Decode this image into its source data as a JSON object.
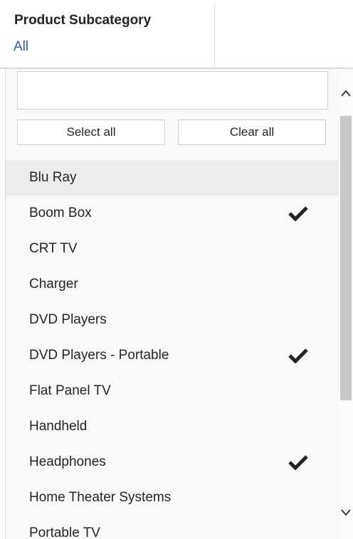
{
  "slicer": {
    "title": "Product Subcategory",
    "selected_value": "All",
    "search_value": "",
    "select_all_label": "Select all",
    "clear_all_label": "Clear all",
    "items": [
      {
        "label": "Blu Ray",
        "checked": false,
        "hovered": true
      },
      {
        "label": "Boom Box",
        "checked": true,
        "hovered": false
      },
      {
        "label": "CRT TV",
        "checked": false,
        "hovered": false
      },
      {
        "label": "Charger",
        "checked": false,
        "hovered": false
      },
      {
        "label": "DVD Players",
        "checked": false,
        "hovered": false
      },
      {
        "label": "DVD Players - Portable",
        "checked": true,
        "hovered": false
      },
      {
        "label": "Flat Panel TV",
        "checked": false,
        "hovered": false
      },
      {
        "label": "Handheld",
        "checked": false,
        "hovered": false
      },
      {
        "label": "Headphones",
        "checked": true,
        "hovered": false
      },
      {
        "label": "Home Theater Systems",
        "checked": false,
        "hovered": false
      },
      {
        "label": "Portable TV",
        "checked": false,
        "hovered": false
      }
    ],
    "icons": {
      "check": "checkmark-icon",
      "scroll_up": "chevron-up-icon",
      "scroll_down": "chevron-down-icon"
    },
    "colors": {
      "value_text": "#2e5aa8",
      "hover_row": "#ececec",
      "panel_bg": "#f8f9f8"
    }
  }
}
